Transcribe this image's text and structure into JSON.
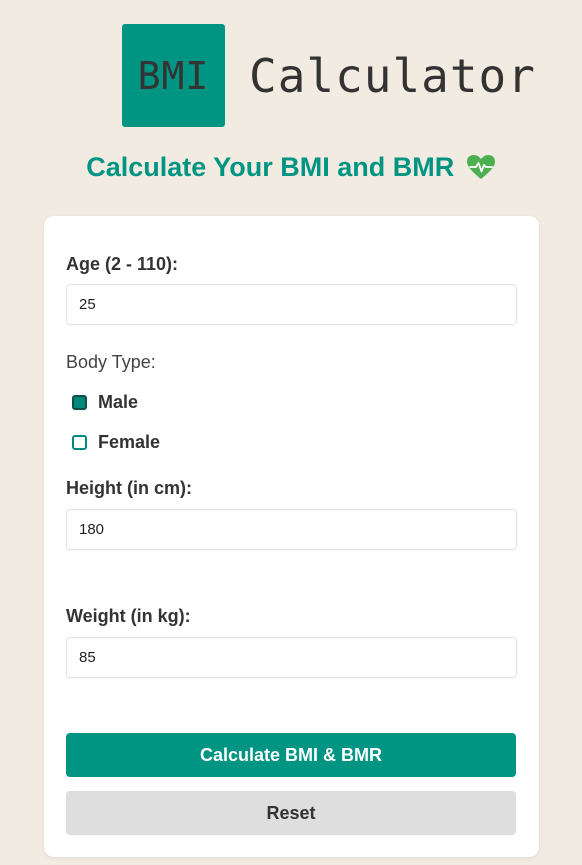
{
  "header": {
    "logo_text": "BMI",
    "logo_word": "Calculator"
  },
  "subtitle": "Calculate Your BMI and BMR",
  "form": {
    "age_label": "Age (2 - 110):",
    "age_value": "25",
    "body_type_label": "Body Type:",
    "options": [
      {
        "label": "Male",
        "checked": true
      },
      {
        "label": "Female",
        "checked": false
      }
    ],
    "height_label": "Height (in cm):",
    "height_value": "180",
    "weight_label": "Weight (in kg):",
    "weight_value": "85"
  },
  "buttons": {
    "calculate_label": "Calculate BMI & BMR",
    "reset_label": "Reset"
  },
  "colors": {
    "accent": "#009483",
    "background": "#f2ebe1",
    "heart": "#4caf50"
  },
  "icons": {
    "heart": "heartbeat-icon"
  }
}
